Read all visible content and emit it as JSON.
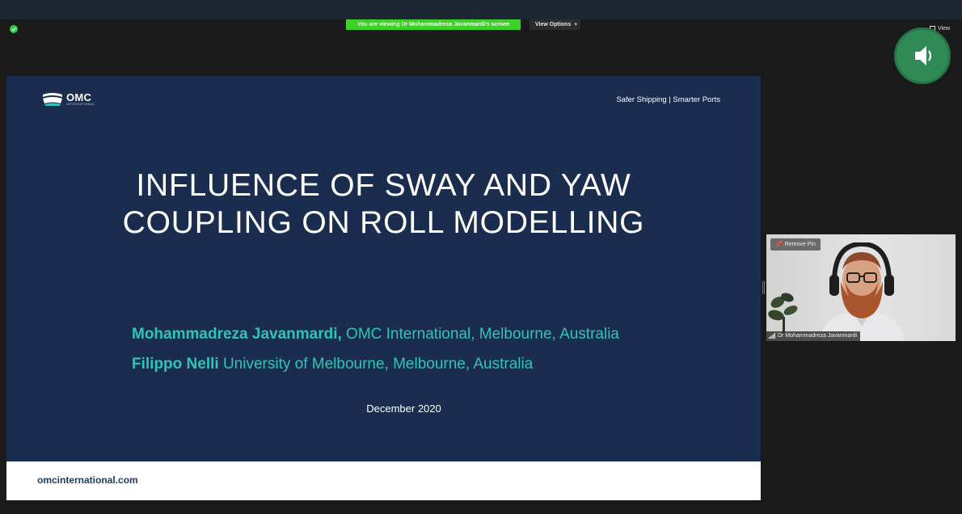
{
  "share_banner": {
    "text": "You are viewing Dr Mohammadreza Javanmardi's screen",
    "view_options_label": "View Options",
    "banner_color": "#3fcf29"
  },
  "toolbar": {
    "view_label": "View",
    "encryption_icon": "shield-check-icon",
    "audio_icon": "speaker-icon"
  },
  "slide": {
    "logo_text": "OMC",
    "logo_subtext": "INTERNATIONAL",
    "tagline": "Safer Shipping | Smarter Ports",
    "title_line1": "INFLUENCE OF SWAY AND YAW",
    "title_line2": "COUPLING ON ROLL MODELLING",
    "authors": [
      {
        "name": "Mohammadreza Javanmardi,",
        "affiliation": "OMC International, Melbourne, Australia"
      },
      {
        "name": "Filippo Nelli",
        "affiliation": "University of Melbourne, Melbourne, Australia"
      }
    ],
    "date": "December 2020",
    "footer_url": "omcinternational.com",
    "background_color": "#1a2d4f",
    "accent_color": "#2ec4b6"
  },
  "video": {
    "remove_pin_label": "Remove Pin",
    "participant_name": "Dr Mohammadreza Javanmardi"
  }
}
